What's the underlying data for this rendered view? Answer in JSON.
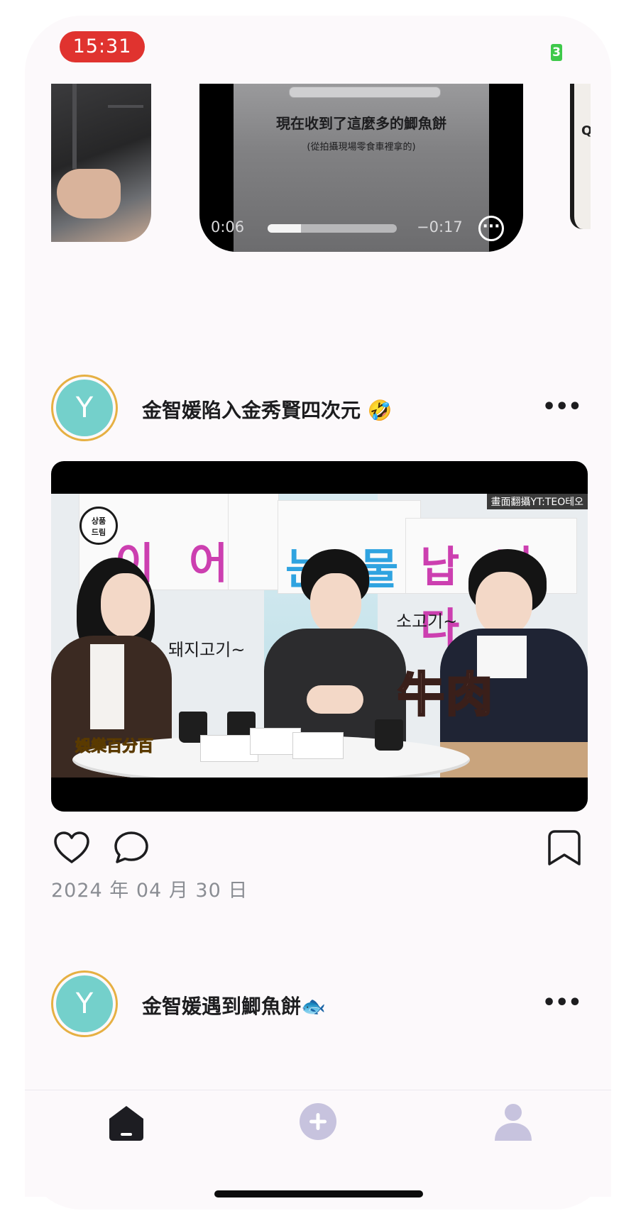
{
  "status_bar": {
    "time": "15:31",
    "battery_level": "3"
  },
  "carousel": {
    "video": {
      "subtitle_main": "現在收到了這麼多的鯽魚餅",
      "subtitle_sub": "(從拍攝現場零食車裡拿的)",
      "elapsed": "0:06",
      "remaining": "−0:17",
      "progress": 0.26
    },
    "right_peek_text": "Q"
  },
  "posts": [
    {
      "avatar_letter": "Y",
      "title": "金智媛陷入金秀賢四次元 🤣",
      "more": "•••",
      "media": {
        "watermark": "畫面翻攝YT:TEO테오",
        "caption_left": "돼지고기~",
        "caption_right": "소고기~",
        "caption_big": "牛肉",
        "channel_logo": "娛樂百分百",
        "signboard_line1": "이 어",
        "signboard_line2": "눈 물",
        "signboard_line3": "납 니 다"
      },
      "date": "2024 年 04 月 30 日"
    },
    {
      "avatar_letter": "Y",
      "title": "金智媛遇到鯽魚餅🐟",
      "more": "•••"
    }
  ],
  "tab_bar": {
    "items": [
      "home",
      "create",
      "profile"
    ],
    "active": "home"
  },
  "colors": {
    "background": "#fcf9fb",
    "avatar_ring": "#e6b043",
    "avatar_fill": "#74d0cb",
    "time_pill": "#e0332f",
    "tab_inactive": "#c7c3de",
    "tab_active": "#1d1d22"
  }
}
